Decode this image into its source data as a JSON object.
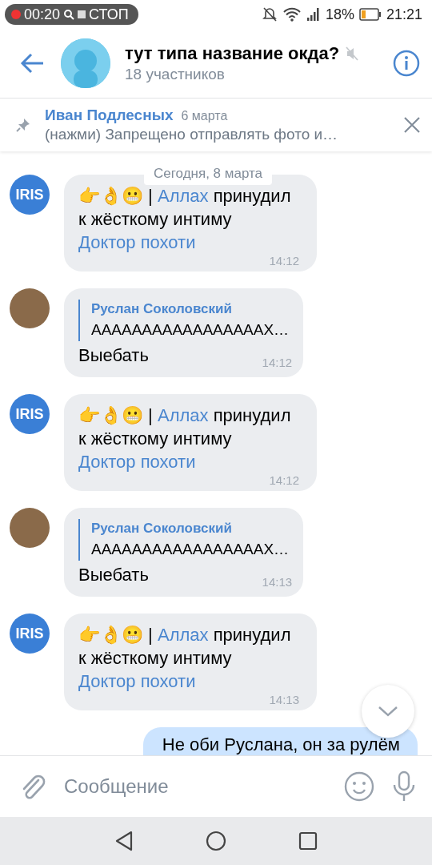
{
  "status_bar": {
    "recording_time": "00:20",
    "stop_label": "СТОП",
    "battery": "18%",
    "time": "21:21"
  },
  "header": {
    "title": "тут типа название окда?",
    "subtitle": "18 участников",
    "muted": true
  },
  "pinned": {
    "author": "Иван Подлесных",
    "date": "6 марта",
    "text": "(нажми) Запрещено отправлять фото и…"
  },
  "date_separator": "Сегодня, 8 марта",
  "messages": [
    {
      "kind": "bot",
      "avatar": "IRIS",
      "parts": [
        {
          "text": "👉👌😬 | ",
          "link": false
        },
        {
          "text": "Аллах",
          "link": true
        },
        {
          "text": " принудил к жёсткому интиму ",
          "link": false
        },
        {
          "text": "Доктор похоти",
          "link": true
        }
      ],
      "time": "14:12"
    },
    {
      "kind": "reply",
      "quote_author": "Руслан Соколовский",
      "quote_text": "АААААААААААААААААХ…",
      "text": "Выебать",
      "time": "14:12"
    },
    {
      "kind": "bot",
      "avatar": "IRIS",
      "parts": [
        {
          "text": "👉👌😬 | ",
          "link": false
        },
        {
          "text": "Аллах",
          "link": true
        },
        {
          "text": " принудил к жёсткому интиму ",
          "link": false
        },
        {
          "text": "Доктор похоти",
          "link": true
        }
      ],
      "time": "14:12"
    },
    {
      "kind": "reply",
      "quote_author": "Руслан Соколовский",
      "quote_text": "АААААААААААААААААХ…",
      "text": "Выебать",
      "time": "14:13"
    },
    {
      "kind": "bot",
      "avatar": "IRIS",
      "parts": [
        {
          "text": "👉👌😬 | ",
          "link": false
        },
        {
          "text": "Аллах",
          "link": true
        },
        {
          "text": " принудил к жёсткому интиму ",
          "link": false
        },
        {
          "text": "Доктор похоти",
          "link": true
        }
      ],
      "time": "14:13"
    },
    {
      "kind": "outgoing",
      "text": "Не оби Руслана, он за рулём"
    }
  ],
  "composer": {
    "placeholder": "Сообщение"
  }
}
